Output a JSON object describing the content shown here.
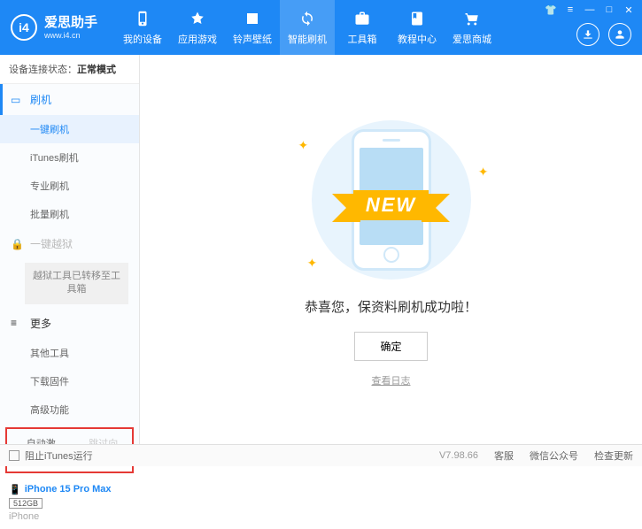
{
  "brand": {
    "title": "爱思助手",
    "sub": "www.i4.cn",
    "logo_letter": "i4"
  },
  "nav": [
    {
      "label": "我的设备"
    },
    {
      "label": "应用游戏"
    },
    {
      "label": "铃声壁纸"
    },
    {
      "label": "智能刷机"
    },
    {
      "label": "工具箱"
    },
    {
      "label": "教程中心"
    },
    {
      "label": "爱思商城"
    }
  ],
  "status": {
    "label": "设备连接状态：",
    "value": "正常模式"
  },
  "sidebar": {
    "flash": {
      "title": "刷机",
      "items": [
        "一键刷机",
        "iTunes刷机",
        "专业刷机",
        "批量刷机"
      ]
    },
    "jailbreak": {
      "title": "一键越狱",
      "note": "越狱工具已转移至工具箱"
    },
    "more": {
      "title": "更多",
      "items": [
        "其他工具",
        "下载固件",
        "高级功能"
      ]
    },
    "checks": {
      "auto_activate": "自动激活",
      "skip_guide": "跳过向导"
    }
  },
  "device": {
    "name": "iPhone 15 Pro Max",
    "storage": "512GB",
    "type": "iPhone"
  },
  "main": {
    "ribbon": "NEW",
    "result": "恭喜您，保资料刷机成功啦！",
    "ok": "确定",
    "log": "查看日志"
  },
  "footer": {
    "block_itunes": "阻止iTunes运行",
    "version": "V7.98.66",
    "links": [
      "客服",
      "微信公众号",
      "检查更新"
    ]
  }
}
